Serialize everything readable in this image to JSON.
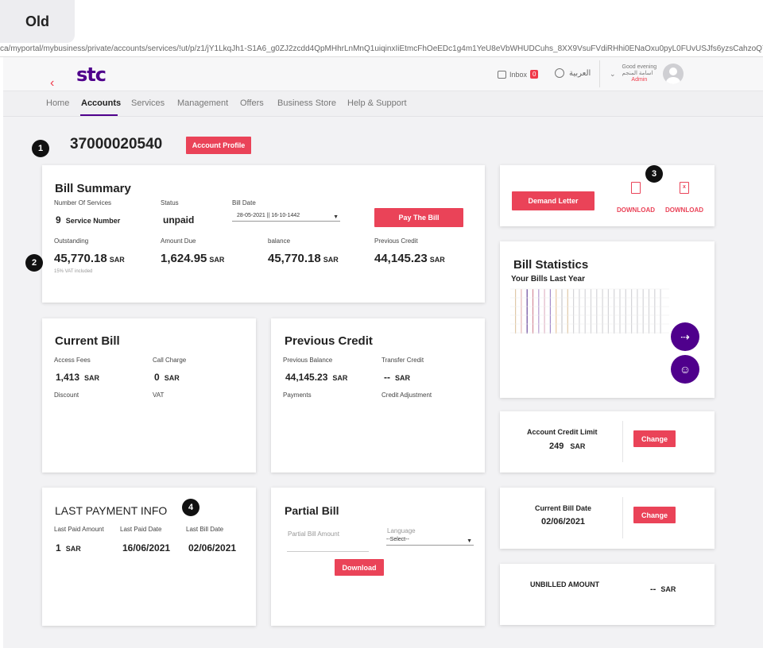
{
  "tag": "Old",
  "url": "ca/myportal/mybusiness/private/accounts/services/!ut/p/z1/jY1LkqJh1-S1A6_g0ZJ2zcdd4QpMHhrLnMnQ1uiqinxIiEtmcFhOeEDc1g4m1YeU8eVbWHUDCuhs_8XX9VsuFVdiRHhi0ENaOxu0pyL0FUvUSJfs6yzsCahzoQYx4jhGHkMoxS-ServicesHAE0XHl0M4RDm8D9HtoKilu-9Ul8H2j8tl9HtyhC9CQ7QXM2oOH95zpgQzgHJ3o5Ca",
  "header": {
    "logo": "stc",
    "inbox_label": "Inbox",
    "inbox_count": "0",
    "language": "العربية",
    "greeting": "Good evening",
    "username": "اسامة المنجم",
    "role": "Admin"
  },
  "nav": [
    "Home",
    "Accounts",
    "Services",
    "Management",
    "Offers",
    "Business Store",
    "Help & Support"
  ],
  "account": {
    "number": "37000020540",
    "profile_button": "Account Profile"
  },
  "markers": [
    "1",
    "2",
    "3",
    "4"
  ],
  "bill_summary": {
    "title": "Bill Summary",
    "num_services_label": "Number Of Services",
    "num_services": "9",
    "num_services_unit": "Service Number",
    "status_label": "Status",
    "status": "unpaid",
    "bill_date_label": "Bill Date",
    "bill_date": "28-05-2021 || 16-10-1442",
    "pay_button": "Pay The Bill",
    "outstanding_label": "Outstanding",
    "outstanding": "45,770.18",
    "amount_due_label": "Amount Due",
    "amount_due": "1,624.95",
    "balance_label": "balance",
    "balance": "45,770.18",
    "prev_credit_label": "Previous Credit",
    "prev_credit": "44,145.23",
    "currency": "SAR",
    "vat_note": "15% VAT included"
  },
  "actions": {
    "demand_letter": "Demand Letter",
    "download1": "DOWNLOAD",
    "download2": "DOWNLOAD",
    "pdf_icon": "pdf-icon",
    "excel_icon": "excel-icon"
  },
  "stats": {
    "title": "Bill Statistics",
    "subtitle": "Your Bills Last Year",
    "fab1": "signpost-icon",
    "fab2": "chat-icon"
  },
  "current_bill": {
    "title": "Current Bill",
    "access_fees_label": "Access Fees",
    "access_fees": "1,413",
    "call_charge_label": "Call Charge",
    "call_charge": "0",
    "discount_label": "Discount",
    "vat_label": "VAT",
    "currency": "SAR"
  },
  "previous_credit": {
    "title": "Previous Credit",
    "prev_balance_label": "Previous Balance",
    "prev_balance": "44,145.23",
    "transfer_label": "Transfer Credit",
    "transfer": "--",
    "payments_label": "Payments",
    "adjust_label": "Credit Adjustment",
    "currency": "SAR"
  },
  "credit_limit": {
    "label": "Account Credit Limit",
    "value": "249",
    "currency": "SAR",
    "button": "Change"
  },
  "last_payment": {
    "title": "LAST PAYMENT INFO",
    "paid_amount_label": "Last Paid Amount",
    "paid_amount": "1",
    "paid_date_label": "Last Paid Date",
    "paid_date": "16/06/2021",
    "bill_date_label": "Last Bill Date",
    "bill_date": "02/06/2021",
    "currency": "SAR"
  },
  "partial_bill": {
    "title": "Partial Bill",
    "amount_placeholder": "Partial Bill Amount",
    "language_label": "Language",
    "language_value": "--Select--",
    "download": "Download"
  },
  "current_bill_date": {
    "label": "Current Bill Date",
    "value": "02/06/2021",
    "button": "Change"
  },
  "unbilled": {
    "label": "UNBILLED AMOUNT",
    "value": "--",
    "currency": "SAR"
  }
}
